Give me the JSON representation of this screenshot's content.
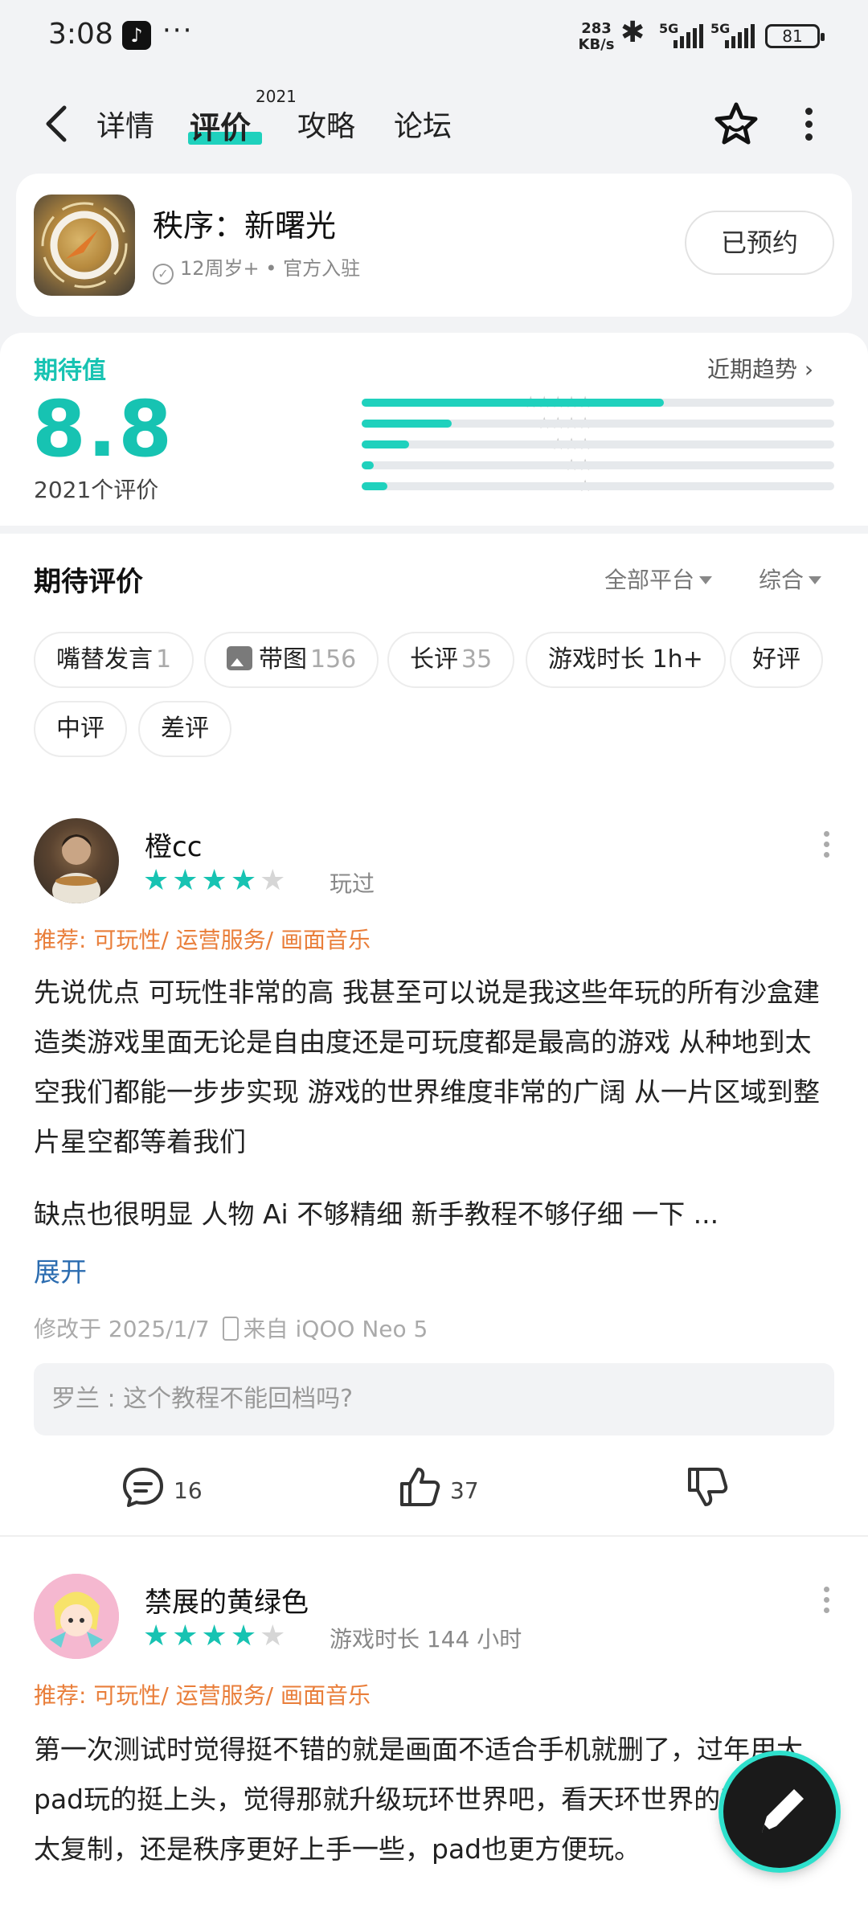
{
  "status": {
    "time": "3:08",
    "dots": "···",
    "speed_value": "283",
    "speed_unit": "KB/s",
    "sig1": "5G",
    "sig2": "5G",
    "battery": "81"
  },
  "nav": {
    "tabs": [
      {
        "label": "详情"
      },
      {
        "label": "评价",
        "active": true,
        "badge": "2021"
      },
      {
        "label": "攻略"
      },
      {
        "label": "论坛"
      }
    ]
  },
  "game": {
    "name": "秩序：新曙光",
    "age": "12周岁+",
    "sep": "•",
    "official": "官方入驻",
    "action_label": "已预约"
  },
  "rating": {
    "title": "期待值",
    "score": "8.8",
    "count_label": "2021个评价",
    "trend_label": "近期趋势",
    "distribution": [
      {
        "stars": 5,
        "fraction": 0.64
      },
      {
        "stars": 4,
        "fraction": 0.19
      },
      {
        "stars": 3,
        "fraction": 0.1
      },
      {
        "stars": 2,
        "fraction": 0.025
      },
      {
        "stars": 1,
        "fraction": 0.055
      }
    ]
  },
  "reviews_header": {
    "title": "期待评价",
    "platform_filter": "全部平台",
    "sort_filter": "综合"
  },
  "chips": [
    {
      "label": "嘴替发言",
      "count": "1"
    },
    {
      "label": "带图",
      "count": "156",
      "icon": "image-icon"
    },
    {
      "label": "长评",
      "count": "35"
    },
    {
      "label": "游戏时长 1h+"
    },
    {
      "label": "好评"
    },
    {
      "label": "中评"
    },
    {
      "label": "差评"
    }
  ],
  "reviews": [
    {
      "username": "橙cc",
      "stars_on": "★★★★",
      "stars_off": "★",
      "rating": 4,
      "played": "玩过",
      "recommend": "推荐: 可玩性/ 运营服务/ 画面音乐",
      "paragraph1": "先说优点 可玩性非常的高 我甚至可以说是我这些年玩的所有沙盒建造类游戏里面无论是自由度还是可玩度都是最高的游戏 从种地到太空我们都能一步步实现 游戏的世界维度非常的广阔 从一片区域到整片星空都等着我们",
      "paragraph2": "缺点也很明显 人物 Ai 不够精细 新手教程不够仔细 一下 ...",
      "expand_label": "展开",
      "edited": "修改于 2025/1/7",
      "device": "来自 iQOO Neo 5",
      "reply": "罗兰 : 这个教程不能回档吗?",
      "comments": "16",
      "likes": "37"
    },
    {
      "username": "禁展的黄绿色",
      "stars_on": "★★★★",
      "stars_off": "★",
      "rating": 4,
      "played": "游戏时长 144 小时",
      "recommend": "推荐: 可玩性/ 运营服务/ 画面音乐",
      "paragraph1": "第一次测试时觉得挺不错的就是画面不适合手机就删了，过年用大pad玩的挺上头，觉得那就升级玩环世界吧，看天环世界的教程觉得太复制，还是秩序更好上手一些，pad也更方便玩。"
    }
  ],
  "colors": {
    "accent": "#17c3b2",
    "recommend": "#e97e3a",
    "link": "#2b6cb0"
  }
}
